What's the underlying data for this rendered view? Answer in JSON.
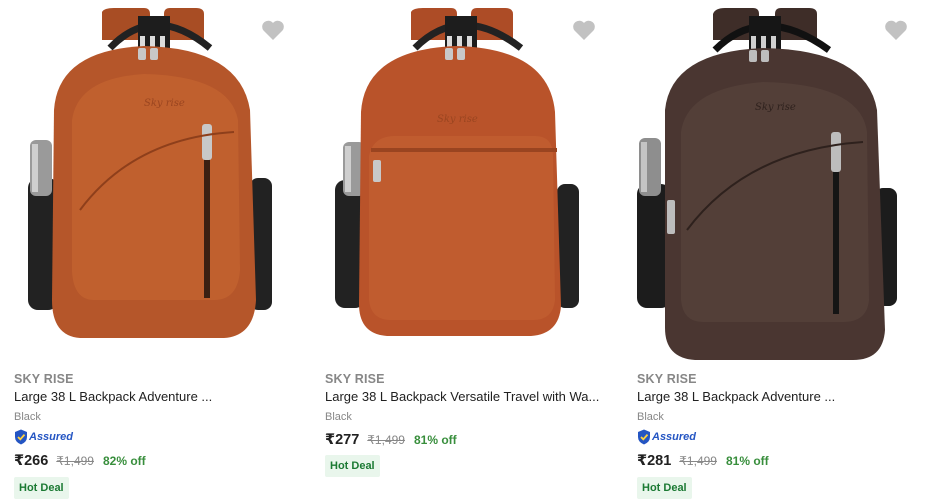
{
  "products": [
    {
      "brand": "SKY RISE",
      "title": "Large 38 L Backpack Adventure ...",
      "color": "Black",
      "assured": "Assured",
      "price": "₹266",
      "mrp": "₹1,499",
      "discount": "82% off",
      "deal": "Hot Deal",
      "bag_color": "#b5562a"
    },
    {
      "brand": "SKY RISE",
      "title": "Large 38 L Backpack Versatile Travel with Wa...",
      "color": "Black",
      "assured": "",
      "price": "₹277",
      "mrp": "₹1,499",
      "discount": "81% off",
      "deal": "Hot Deal",
      "bag_color": "#b9532a"
    },
    {
      "brand": "SKY RISE",
      "title": "Large 38 L Backpack Adventure ...",
      "color": "Black",
      "assured": "Assured",
      "price": "₹281",
      "mrp": "₹1,499",
      "discount": "81% off",
      "deal": "Hot Deal",
      "bag_color": "#4a3631"
    }
  ],
  "icons": {
    "wishlist": "heart-icon",
    "assured": "assured-badge-icon"
  },
  "colors": {
    "wishlist_heart": "#c2c2c2",
    "discount": "#388e3c",
    "assured": "#2455c3",
    "deal_bg": "#e9f6ec",
    "deal_text": "#1b7a33"
  }
}
